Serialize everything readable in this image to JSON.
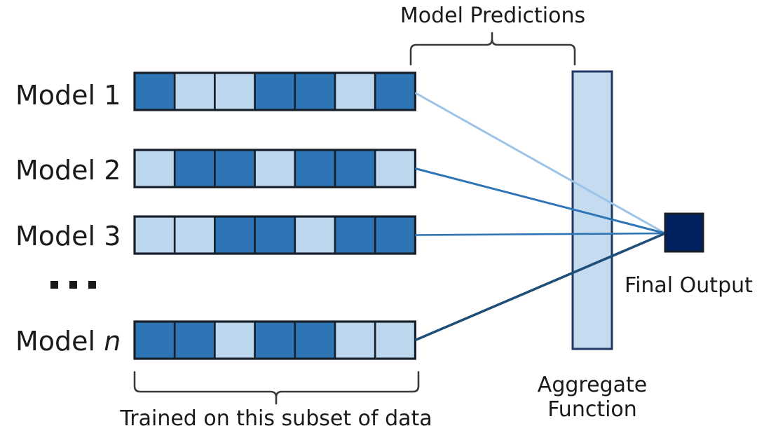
{
  "figure": {
    "title_top": "Model Predictions",
    "caption_bottom": "Trained on this subset of data",
    "aggregate_label_line1": "Aggregate",
    "aggregate_label_line2": "Function",
    "final_output_label": "Final Output",
    "ellipsis": "..."
  },
  "colors": {
    "dark_blue": "#2E75B6",
    "light_blue": "#BDD7EE",
    "navy": "#002060",
    "outline": "#17202A",
    "aggregate_fill": "#BDD7EE",
    "aggregate_stroke": "#1F3864",
    "bracket": "#3a3a3a",
    "line_model_1": "#9DC3E6",
    "line_model_2": "#2E75B6",
    "line_model_3": "#2E75B6",
    "line_model_n": "#1F4E79"
  },
  "rows": [
    {
      "label_prefix": "Model",
      "label_suffix": "1",
      "label_suffix_italic": false,
      "cells": [
        "dark",
        "light",
        "light",
        "dark",
        "dark",
        "light",
        "dark"
      ]
    },
    {
      "label_prefix": "Model",
      "label_suffix": "2",
      "label_suffix_italic": false,
      "cells": [
        "light",
        "dark",
        "dark",
        "light",
        "dark",
        "dark",
        "light"
      ]
    },
    {
      "label_prefix": "Model",
      "label_suffix": "3",
      "label_suffix_italic": false,
      "cells": [
        "light",
        "light",
        "dark",
        "dark",
        "light",
        "dark",
        "dark"
      ]
    },
    {
      "label_prefix": "Model",
      "label_suffix": "n",
      "label_suffix_italic": true,
      "cells": [
        "dark",
        "dark",
        "light",
        "dark",
        "dark",
        "light",
        "light"
      ]
    }
  ],
  "chart_data": {
    "type": "diagram",
    "title": "Model Predictions",
    "description": "Ensemble learning diagram: n models each trained on a subset of data produce predictions that feed an aggregate function yielding a final output.",
    "n_models": 4,
    "n_cells_per_model": 7,
    "legend": [
      {
        "name": "dark",
        "color": "#2E75B6",
        "meaning": "selected data subset cell"
      },
      {
        "name": "light",
        "color": "#BDD7EE",
        "meaning": "unselected data subset cell"
      }
    ],
    "annotations": [
      "Model Predictions",
      "Trained on this subset of data",
      "Aggregate Function",
      "Final Output"
    ]
  }
}
